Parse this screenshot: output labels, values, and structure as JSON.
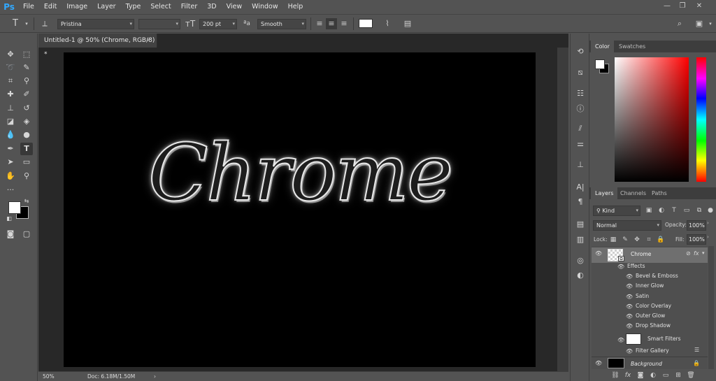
{
  "app": {
    "logo": "Ps"
  },
  "menu": [
    "File",
    "Edit",
    "Image",
    "Layer",
    "Type",
    "Select",
    "Filter",
    "3D",
    "View",
    "Window",
    "Help"
  ],
  "window_controls": {
    "minimize": "—",
    "restore": "❐",
    "close": "✕"
  },
  "options": {
    "tool_icon": "T",
    "font_family": "Pristina",
    "font_size": "200 pt",
    "aa_icon": "ªa",
    "antialias": "Smooth",
    "text_color": "#ffffff"
  },
  "document": {
    "tab_title": "Untitled-1 @ 50% (Chrome, RGB/8) *",
    "tab_close": "×",
    "canvas_text": "Chrome",
    "zoom": "50%",
    "doc_info": "Doc: 6.18M/1.50M",
    "status_arrow": "›"
  },
  "tools": [
    "move-icon",
    "marquee-icon",
    "lasso-icon",
    "quick-select-icon",
    "crop-icon",
    "eyedropper-icon",
    "healing-icon",
    "brush-icon",
    "stamp-icon",
    "history-brush-icon",
    "eraser-icon",
    "paint-bucket-icon",
    "blur-icon",
    "dodge-icon",
    "pen-icon",
    "type-icon",
    "path-select-icon",
    "rectangle-icon",
    "hand-icon",
    "zoom-icon",
    "more-icon"
  ],
  "colors": {
    "foreground": "#ffffff",
    "background": "#000000",
    "accent": "#31a8ff"
  },
  "color_panel": {
    "tabs": [
      "Color",
      "Swatches"
    ]
  },
  "layers_panel": {
    "tabs": [
      "Layers",
      "Channels",
      "Paths"
    ],
    "filter_kind": "Kind",
    "blend_mode": "Normal",
    "opacity_label": "Opacity:",
    "opacity": "100%",
    "lock_label": "Lock:",
    "fill_label": "Fill:",
    "fill": "100%",
    "layers": [
      {
        "name": "Chrome",
        "fx": "fx"
      },
      {
        "name": "Background"
      }
    ],
    "effects_label": "Effects",
    "effects": [
      "Bevel & Emboss",
      "Inner Glow",
      "Satin",
      "Color Overlay",
      "Outer Glow",
      "Drop Shadow"
    ],
    "smart_filters_label": "Smart Filters",
    "filter_gallery": "Filter Gallery"
  }
}
